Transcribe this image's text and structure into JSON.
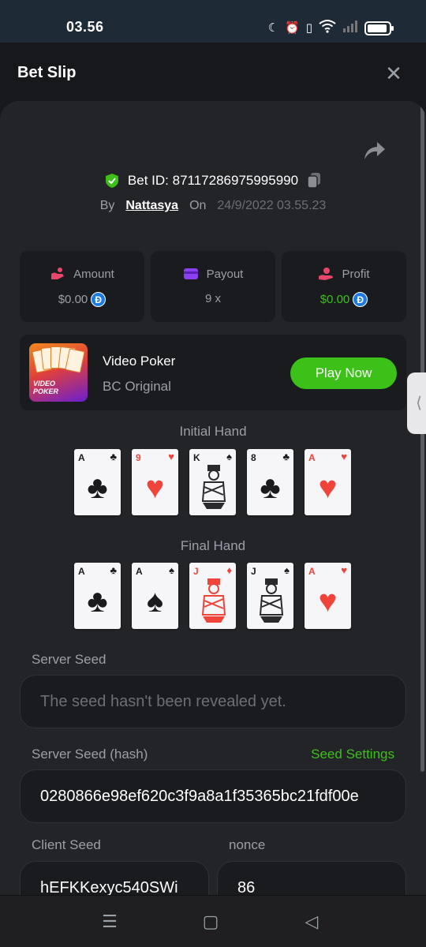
{
  "status_bar": {
    "time": "03.56",
    "icons": [
      "moon-icon",
      "alarm-icon",
      "vibrate-icon",
      "wifi-icon",
      "signal-icon",
      "battery-icon"
    ]
  },
  "header": {
    "title": "Bet Slip",
    "close_icon": "close-icon"
  },
  "bet": {
    "id_text": "Bet ID: 87117286975995990",
    "by_label": "By",
    "user": "Nattasya",
    "on_label": "On",
    "date": "24/9/2022 03.55.23"
  },
  "stats": {
    "amount": {
      "label": "Amount",
      "value": "$0.00"
    },
    "payout": {
      "label": "Payout",
      "value": "9 x"
    },
    "profit": {
      "label": "Profit",
      "value": "$0.00"
    }
  },
  "game": {
    "name": "Video Poker",
    "provider": "BC Original",
    "play_label": "Play Now",
    "thumb_line1": "VIDEO",
    "thumb_line2": "POKER"
  },
  "initial_hand": {
    "label": "Initial Hand",
    "cards": [
      {
        "rank": "A",
        "suit": "♣",
        "color": "black"
      },
      {
        "rank": "9",
        "suit": "♥",
        "color": "red"
      },
      {
        "rank": "K",
        "suit": "♠",
        "color": "black"
      },
      {
        "rank": "8",
        "suit": "♣",
        "color": "black"
      },
      {
        "rank": "A",
        "suit": "♥",
        "color": "red"
      }
    ]
  },
  "final_hand": {
    "label": "Final Hand",
    "cards": [
      {
        "rank": "A",
        "suit": "♣",
        "color": "black"
      },
      {
        "rank": "A",
        "suit": "♠",
        "color": "black"
      },
      {
        "rank": "J",
        "suit": "♦",
        "color": "red"
      },
      {
        "rank": "J",
        "suit": "♠",
        "color": "black"
      },
      {
        "rank": "A",
        "suit": "♥",
        "color": "red"
      }
    ]
  },
  "server_seed": {
    "label": "Server Seed",
    "value": "The seed hasn't been revealed yet."
  },
  "server_seed_hash": {
    "label": "Server Seed (hash)",
    "settings_label": "Seed Settings",
    "value": "0280866e98ef620c3f9a8a1f35365bc21fdf00e"
  },
  "client_seed": {
    "label": "Client Seed",
    "value": "hEFKKexyc540SWi"
  },
  "nonce": {
    "label": "nonce",
    "value": "86"
  },
  "side_tab": "⟨",
  "nav": {
    "menu": "☰",
    "home": "▢",
    "back": "◁"
  },
  "colors": {
    "accent_green": "#3bc117",
    "panel": "#232427",
    "card_red": "#f0443a"
  }
}
